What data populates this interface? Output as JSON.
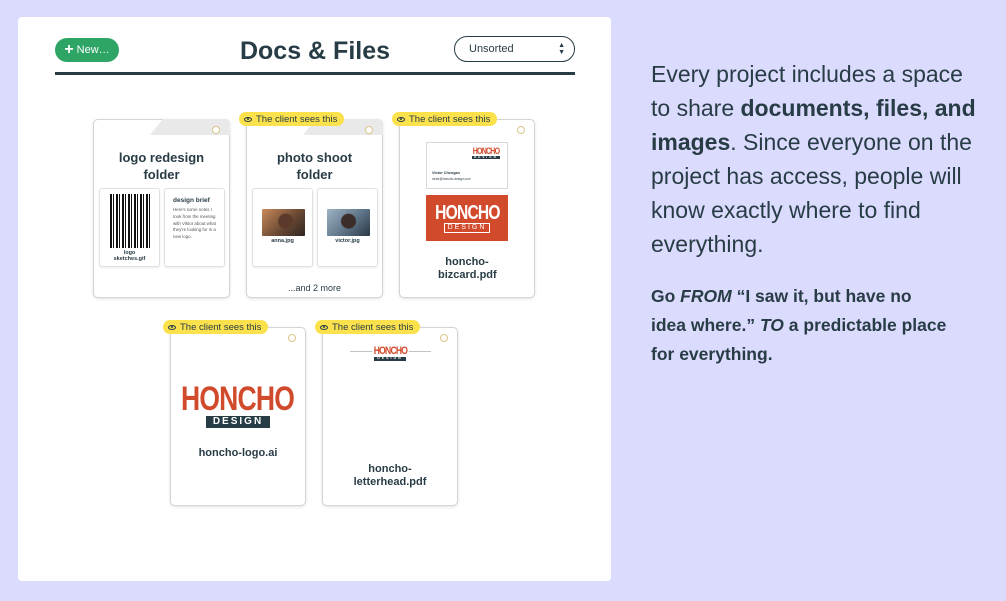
{
  "header": {
    "new_button": "New…",
    "title": "Docs & Files",
    "sort_value": "Unsorted"
  },
  "client_badge": "The client sees this",
  "cards": {
    "logo_folder": {
      "title": "logo redesign folder",
      "files": [
        {
          "name": "logo sketches.gif"
        },
        {
          "name": "design brief",
          "body": "Here's some notes I took from the meeting with Viktor about what they're looking for in a new logo."
        }
      ]
    },
    "photo_folder": {
      "title": "photo shoot folder",
      "files": [
        {
          "name": "anna.jpg"
        },
        {
          "name": "victor.jpg"
        }
      ],
      "more": "...and 2 more"
    },
    "bizcard": {
      "name": "honcho-bizcard.pdf",
      "card_person": "Victor Chengan",
      "card_email": "victor@honcho-design.com"
    },
    "logo_ai": {
      "name": "honcho-logo.ai"
    },
    "letterhead": {
      "name": "honcho-letterhead.pdf"
    }
  },
  "brand": {
    "wordmark": "HONCHO",
    "tagline": "DESIGN",
    "accent": "#d24a2c",
    "ink": "#283c46",
    "green": "#2ea465",
    "badge": "#fbe14c"
  },
  "copy": {
    "p1_a": "Every project includes a space to share ",
    "p1_b": "documents, files, and images",
    "p1_c": ". Since everyone on the project has access, people will know exactly where to find everything.",
    "p2_a": "Go ",
    "p2_b": "FROM",
    "p2_c": " “I saw it, but have no idea where.” ",
    "p2_d": "TO",
    "p2_e": " a predictable place for everything."
  }
}
